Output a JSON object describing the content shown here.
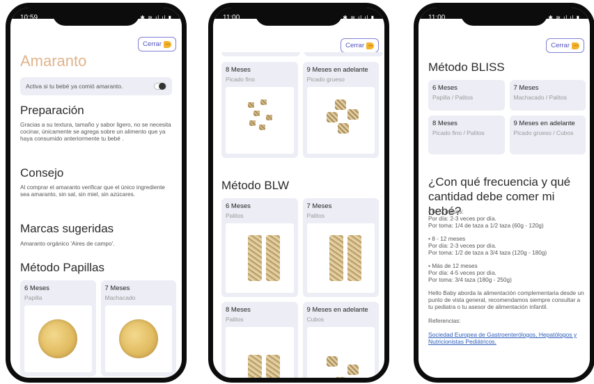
{
  "status": {
    "p1_time": "10:59",
    "p2_time": "11:00",
    "p3_time": "11:00",
    "icons": "✱ ≋.ıl.ıl ▮"
  },
  "close_label": "Cerrar",
  "p1": {
    "title": "Amaranto",
    "toggle_label": "Activa si tu bebé ya comió amaranto.",
    "prep_title": "Preparación",
    "prep_text": "Gracias a su textura, tamaño y sabor ligero, no se necesita cocinar, únicamente se agrega sobre un alimento que ya haya consumido anteriormente tu bebé .",
    "tip_title": "Consejo",
    "tip_text": "Al comprar el amaranto verificar que el único ingrediente sea amaranto, sin sal, sin miel, sin azúcares.",
    "brands_title": "Marcas sugeridas",
    "brands_text": "Amaranto orgánico 'Aires de campo'.",
    "method_title": "Método Papillas",
    "cards": [
      {
        "title": "6 Meses",
        "sub": "Papilla"
      },
      {
        "title": "7 Meses",
        "sub": "Machacado"
      }
    ]
  },
  "p2": {
    "top_cards": [
      {
        "title": "8 Meses",
        "sub": "Picado fino"
      },
      {
        "title": "9 Meses en adelante",
        "sub": "Picado grueso"
      }
    ],
    "blw_title": "Método BLW",
    "blw_cards": [
      {
        "title": "6 Meses",
        "sub": "Palitos"
      },
      {
        "title": "7 Meses",
        "sub": "Palitos"
      },
      {
        "title": "8 Meses",
        "sub": "Palitos"
      },
      {
        "title": "9 Meses en adelante",
        "sub": "Cubos"
      }
    ]
  },
  "p3": {
    "bliss_title": "Método BLISS",
    "bliss_cards": [
      {
        "title": "6 Meses",
        "sub": "Papilla / Palitos"
      },
      {
        "title": "7 Meses",
        "sub": "Machacado / Palitos"
      },
      {
        "title": "8 Meses",
        "sub": "Picado fino / Palitos"
      },
      {
        "title": "9 Meses en adelante",
        "sub": "Picado grueso / Cubos"
      }
    ],
    "freq_title": "¿Con qué frecuencia y qué cantidad debe comer mi bebé?",
    "freq_blocks": [
      {
        "l1": "• 6 - 7 meses:",
        "l2": "Por día: 2-3 veces por día.",
        "l3": "Por toma: 1/4 de taza a 1/2 taza (60g - 120g)"
      },
      {
        "l1": "• 8 - 12 meses",
        "l2": "Por día: 2-3 veces por día.",
        "l3": "Por toma: 1/2 de taza a 3/4 taza (120g - 180g)"
      },
      {
        "l1": "• Más de 12 meses",
        "l2": "Por día: 4-5 veces por día.",
        "l3": "Por toma: 3/4 taza (180g - 250g)"
      }
    ],
    "disclaimer": "Hello Baby aborda la alimentación complementaria desde un punto de vista general, recomendamos siempre consultar a tu pediatra o tu asesor de alimentación infantil.",
    "refs_label": "Referencias:",
    "ref_link": "Sociedad Europea de Gastroenterólogos, Hepatólogos y Nutricionistas Pediátricos."
  }
}
